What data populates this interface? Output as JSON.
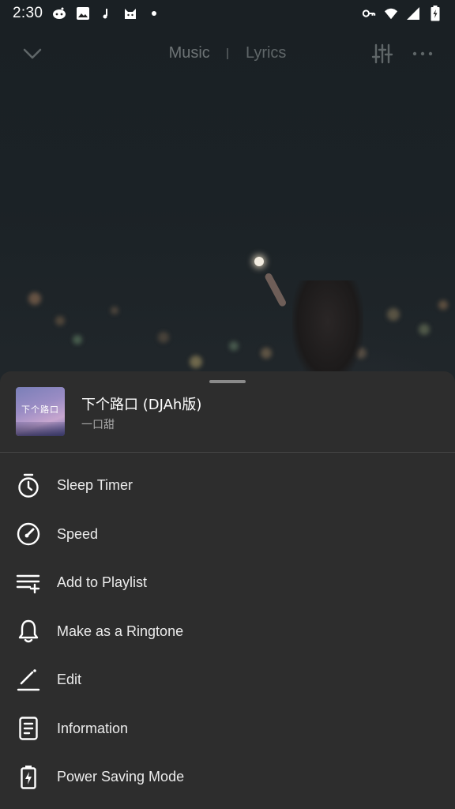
{
  "status_bar": {
    "time": "2:30",
    "left_icons": [
      "reddit-icon",
      "image-icon",
      "music-note-icon",
      "cat-icon",
      "dot-icon"
    ],
    "right_icons": [
      "vpn-key-icon",
      "wifi-icon",
      "signal-icon",
      "battery-charging-icon"
    ]
  },
  "top_nav": {
    "tabs": [
      {
        "label": "Music"
      },
      {
        "label": "Lyrics"
      }
    ]
  },
  "sheet": {
    "song": {
      "title": "下个路口 (DJAh版)",
      "artist": "一口甜",
      "art_text": "下个路口"
    },
    "menu": [
      {
        "label": "Sleep Timer",
        "icon": "timer-icon"
      },
      {
        "label": "Speed",
        "icon": "speedometer-icon"
      },
      {
        "label": "Add to Playlist",
        "icon": "playlist-add-icon"
      },
      {
        "label": "Make as a Ringtone",
        "icon": "bell-icon"
      },
      {
        "label": "Edit",
        "icon": "pencil-icon"
      },
      {
        "label": "Information",
        "icon": "document-icon"
      },
      {
        "label": "Power Saving Mode",
        "icon": "battery-saver-icon"
      }
    ]
  }
}
